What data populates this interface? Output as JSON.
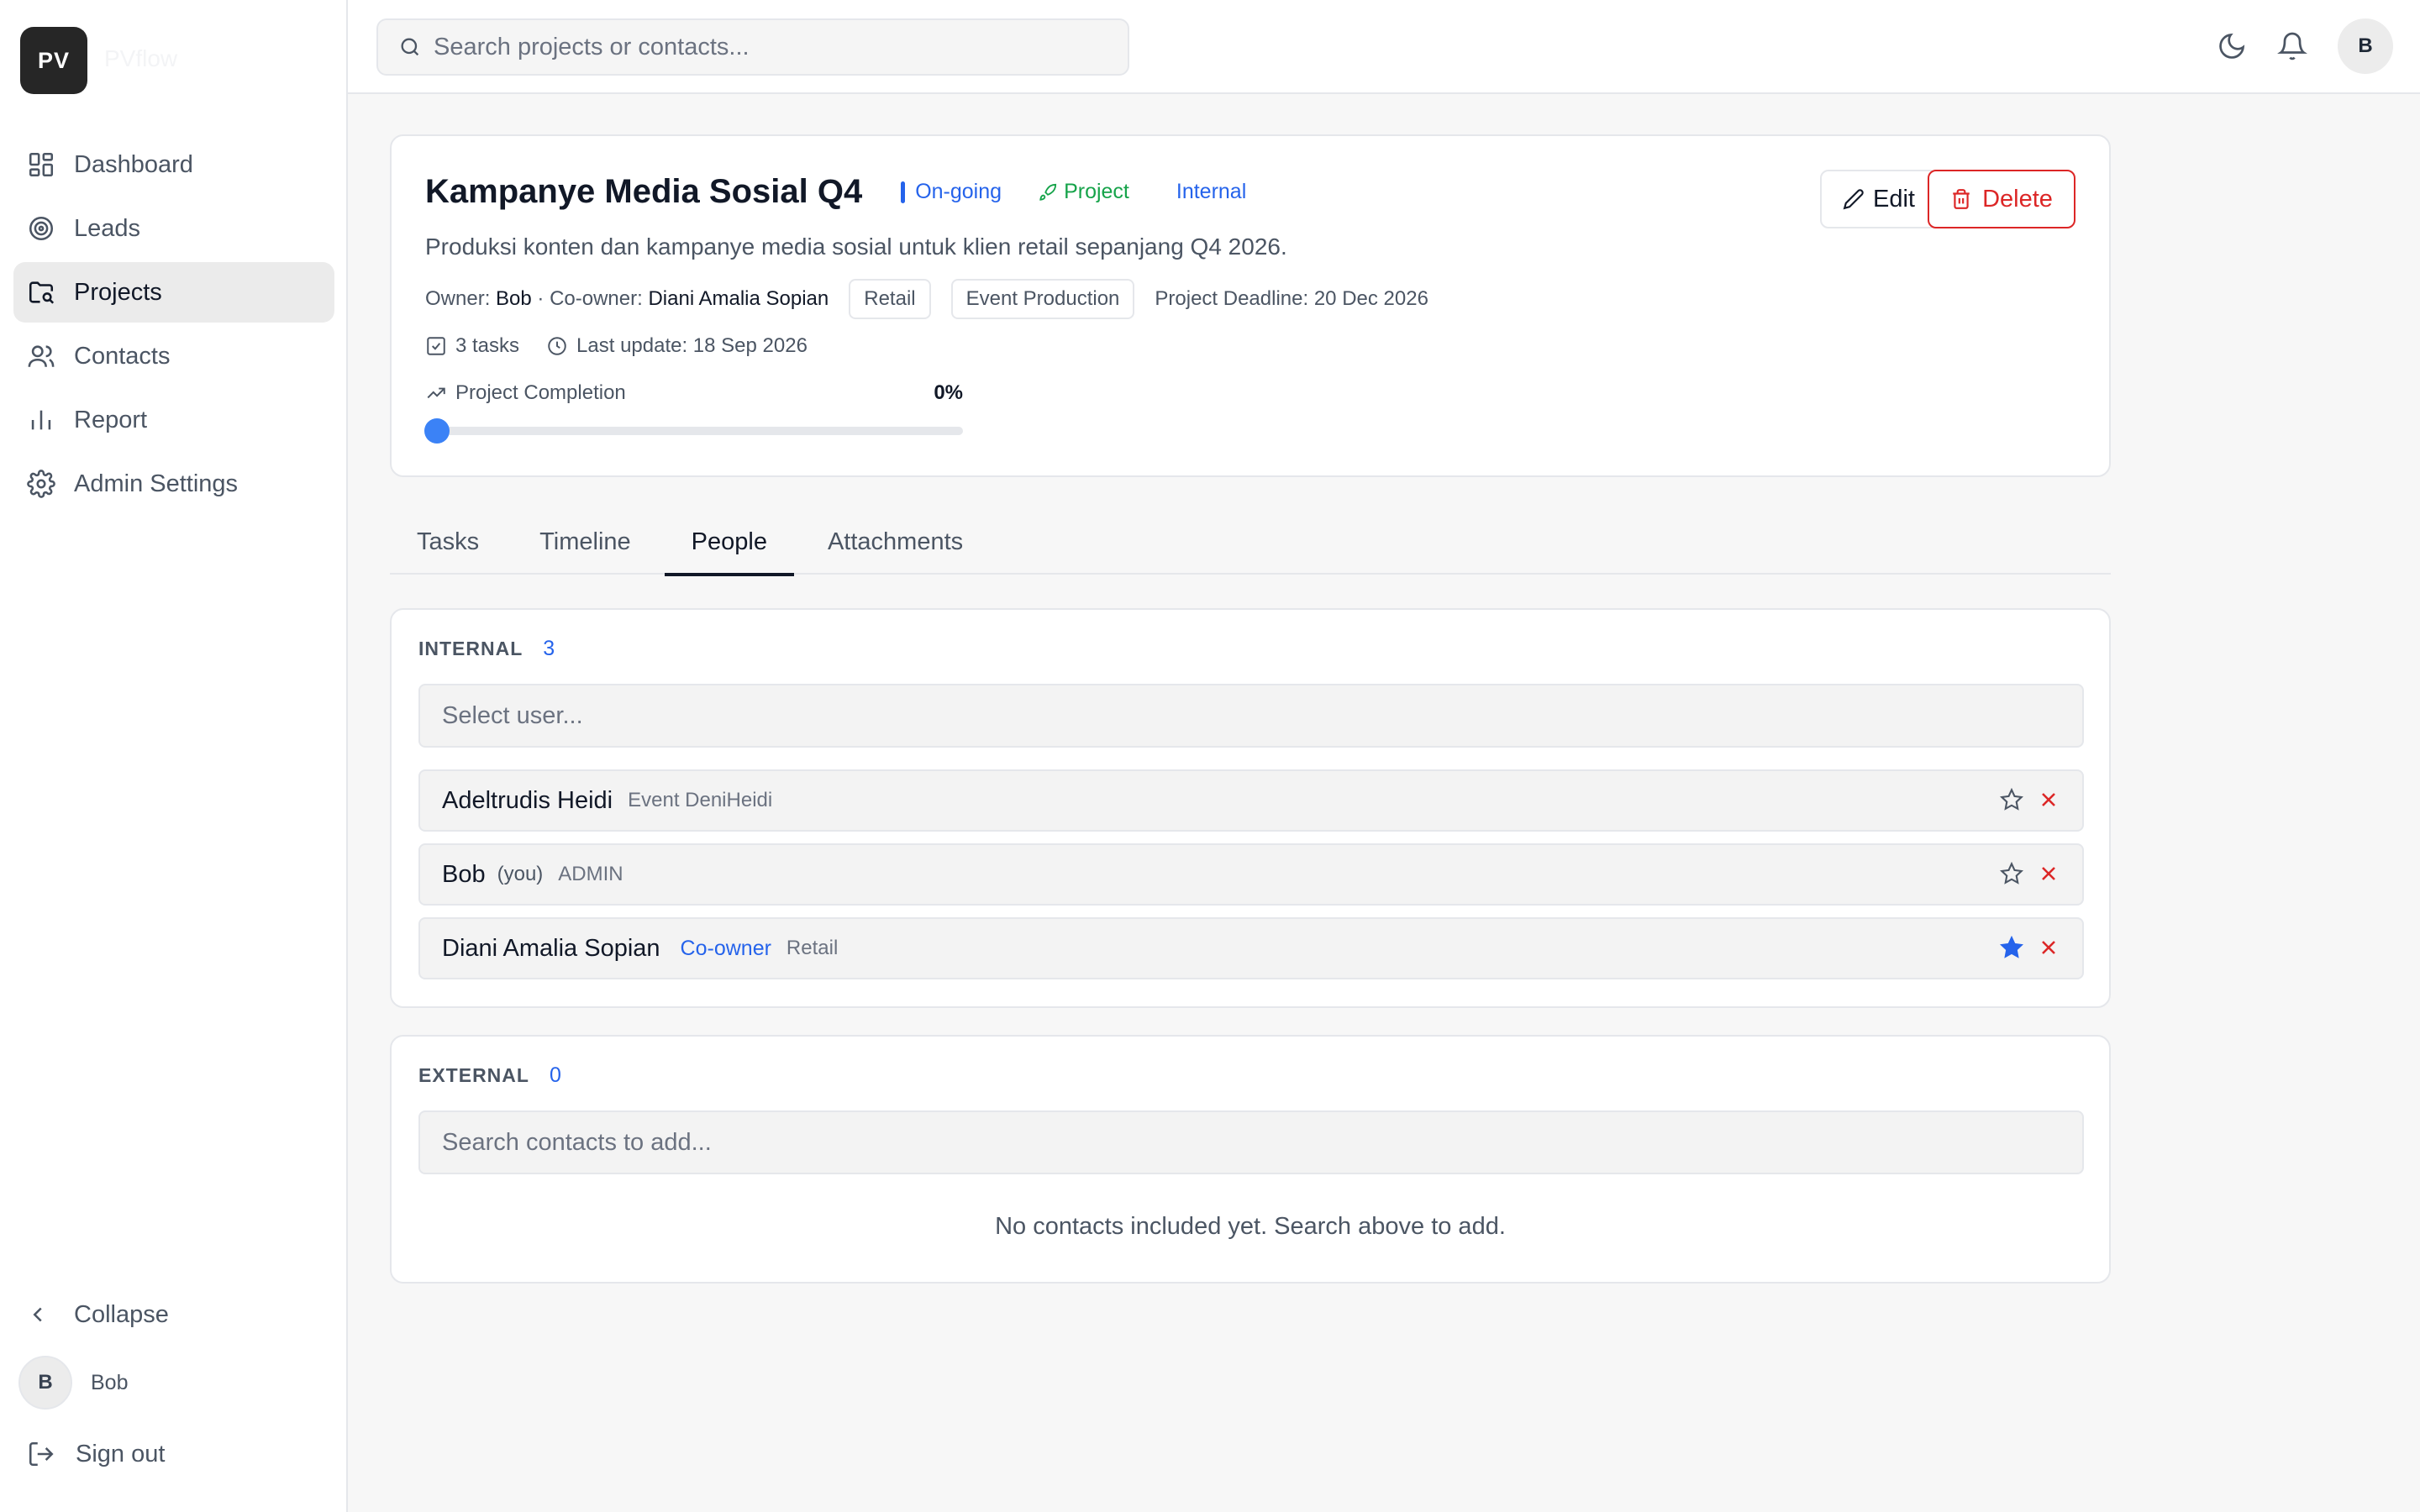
{
  "brand": {
    "initials": "PV",
    "name": "PVflow"
  },
  "sidebar": {
    "items": [
      {
        "label": "Dashboard",
        "icon": "dashboard-icon"
      },
      {
        "label": "Leads",
        "icon": "target-icon"
      },
      {
        "label": "Projects",
        "icon": "folder-icon",
        "active": true
      },
      {
        "label": "Contacts",
        "icon": "users-icon"
      },
      {
        "label": "Report",
        "icon": "bar-chart-icon"
      },
      {
        "label": "Admin Settings",
        "icon": "gear-icon"
      }
    ],
    "collapse_label": "Collapse",
    "user": {
      "initial": "B",
      "name": "Bob"
    },
    "signout_label": "Sign out"
  },
  "topbar": {
    "search_placeholder": "Search projects or contacts...",
    "avatar_initial": "B"
  },
  "project": {
    "title": "Kampanye Media Sosial Q4",
    "status": "On-going",
    "type": "Project",
    "visibility": "Internal",
    "description": "Produksi konten dan kampanye media sosial untuk klien retail sepanjang Q4 2026.",
    "owner_label": "Owner:",
    "owner": "Bob",
    "coowner_label": "· Co-owner:",
    "coowner": "Diani Amalia Sopian",
    "tags": [
      "Retail",
      "Event Production"
    ],
    "deadline": "Project Deadline: 20 Dec 2026",
    "tasks_count": "3 tasks",
    "last_update": "Last update: 18 Sep 2026",
    "completion_label": "Project Completion",
    "completion_text": "0%",
    "completion_value": 0,
    "edit_label": "Edit",
    "delete_label": "Delete"
  },
  "tabs": [
    {
      "label": "Tasks"
    },
    {
      "label": "Timeline"
    },
    {
      "label": "People",
      "active": true
    },
    {
      "label": "Attachments"
    }
  ],
  "internal": {
    "title": "INTERNAL",
    "count": "3",
    "select_placeholder": "Select user...",
    "people": [
      {
        "name": "Adeltrudis Heidi",
        "you": "",
        "coowner": "",
        "role": "Event DeniHeidi",
        "starred": false
      },
      {
        "name": "Bob",
        "you": "(you)",
        "coowner": "",
        "role": "ADMIN",
        "starred": false
      },
      {
        "name": "Diani Amalia Sopian",
        "you": "",
        "coowner": "Co-owner",
        "role": "Retail",
        "starred": true
      }
    ]
  },
  "external": {
    "title": "EXTERNAL",
    "count": "0",
    "search_placeholder": "Search contacts to add...",
    "empty_message": "No contacts included yet. Search above to add."
  },
  "colors": {
    "accent": "#2563eb",
    "danger": "#dc2626",
    "success": "#16a34a",
    "brand_bg": "#262626"
  }
}
